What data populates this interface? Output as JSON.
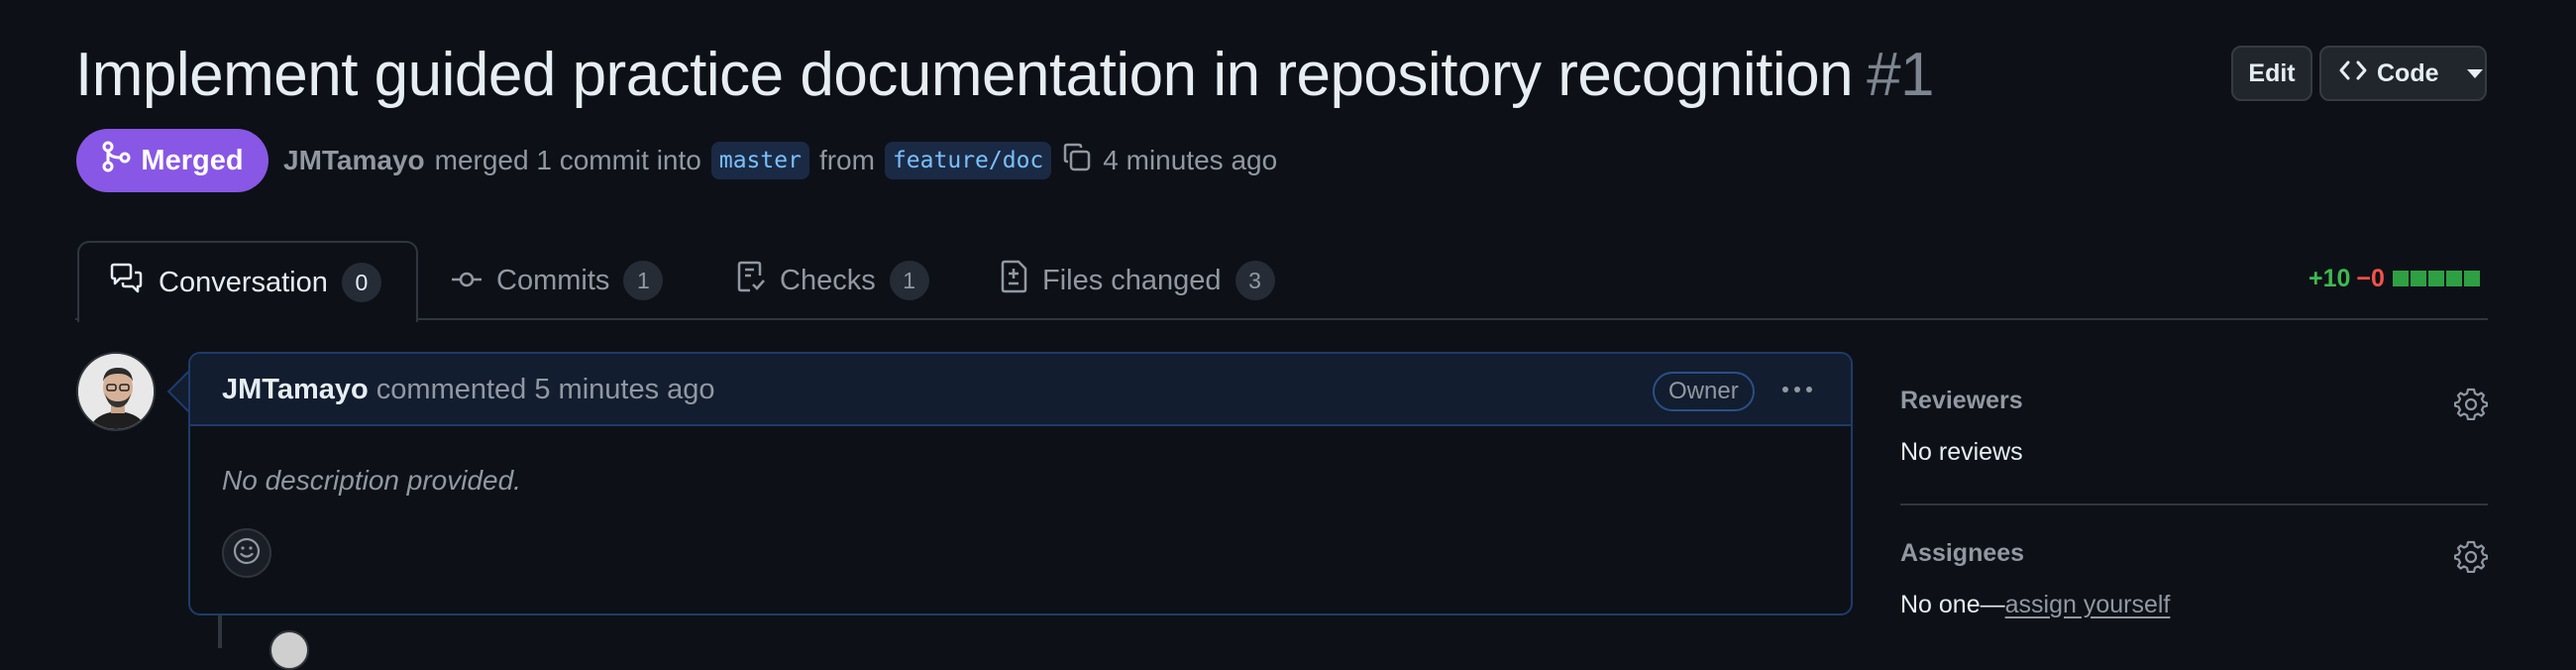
{
  "header": {
    "title": "Implement guided practice documentation in repository recognition",
    "number": "#1",
    "edit_label": "Edit",
    "code_label": "Code"
  },
  "status": {
    "badge_label": "Merged",
    "author": "JMTamayo",
    "merged_text": "merged 1 commit into",
    "base_branch": "master",
    "from_text": "from",
    "head_branch": "feature/doc",
    "time_ago": "4 minutes ago"
  },
  "tabs": [
    {
      "label": "Conversation",
      "count": "0",
      "icon": "comment-discussion-icon"
    },
    {
      "label": "Commits",
      "count": "1",
      "icon": "git-commit-icon"
    },
    {
      "label": "Checks",
      "count": "1",
      "icon": "checklist-icon"
    },
    {
      "label": "Files changed",
      "count": "3",
      "icon": "file-diff-icon"
    }
  ],
  "diffstat": {
    "additions": "+10",
    "deletions": "−0"
  },
  "comment": {
    "author": "JMTamayo",
    "action": "commented 5 minutes ago",
    "role_badge": "Owner",
    "body": "No description provided."
  },
  "sidebar": {
    "reviewers_label": "Reviewers",
    "reviewers_value": "No reviews",
    "assignees_label": "Assignees",
    "assignees_prefix": "No one—",
    "assignees_link": "assign yourself"
  },
  "colors": {
    "background": "#0d1117",
    "merged_purple": "#8957e5",
    "addition_green": "#3fb950",
    "deletion_red": "#f85149",
    "branch_blue": "#79c0ff"
  }
}
